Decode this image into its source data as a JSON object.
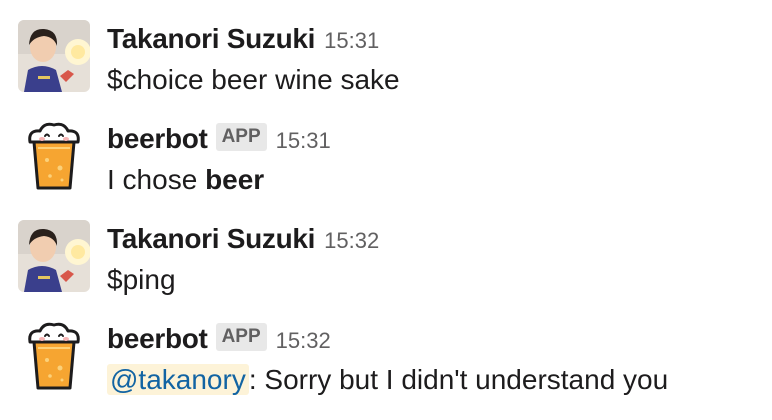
{
  "messages": [
    {
      "author": "Takanori Suzuki",
      "time": "15:31",
      "text": "$choice beer wine sake"
    },
    {
      "author": "beerbot",
      "badge": "APP",
      "time": "15:31",
      "text_prefix": "I chose ",
      "text_bold": "beer"
    },
    {
      "author": "Takanori Suzuki",
      "time": "15:32",
      "text": "$ping"
    },
    {
      "author": "beerbot",
      "badge": "APP",
      "time": "15:32",
      "mention": "@takanory",
      "text_suffix": ": Sorry but I didn't understand you"
    }
  ],
  "icons": {
    "user_avatar": "user-photo-avatar",
    "bot_avatar": "beer-glass-icon"
  },
  "colors": {
    "mention_text": "#1264a3",
    "mention_bg": "#fdf3d8",
    "timestamp": "#616061",
    "badge_bg": "#e8e8e8",
    "beer": "#f6a531"
  }
}
